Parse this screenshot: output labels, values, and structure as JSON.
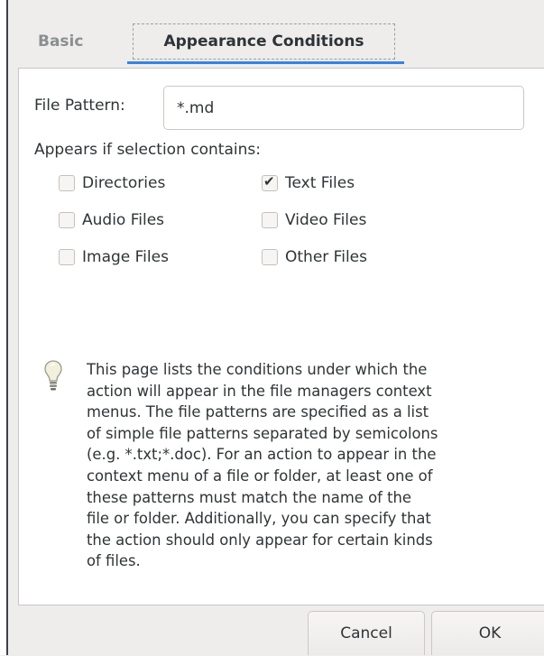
{
  "tabs": [
    {
      "label": "Basic",
      "active": false
    },
    {
      "label": "Appearance Conditions",
      "active": true
    }
  ],
  "file_pattern": {
    "label": "File Pattern:",
    "value": "*.md"
  },
  "appears_label": "Appears if selection contains:",
  "checkboxes": {
    "directories": {
      "label": "Directories",
      "checked": false
    },
    "text_files": {
      "label": "Text Files",
      "checked": true
    },
    "audio_files": {
      "label": "Audio Files",
      "checked": false
    },
    "video_files": {
      "label": "Video Files",
      "checked": false
    },
    "image_files": {
      "label": "Image Files",
      "checked": false
    },
    "other_files": {
      "label": "Other Files",
      "checked": false
    }
  },
  "info_text": "This page lists the conditions under which the\naction will appear in the file managers context\nmenus. The file patterns are specified as a list\nof simple file patterns separated by semicolons\n(e.g. *.txt;*.doc). For an action to appear in the\ncontext menu of a file or folder, at least one of\nthese patterns must match the name of the\nfile or folder. Additionally, you can specify that\nthe action should only appear for certain kinds\nof files.",
  "buttons": {
    "cancel": "Cancel",
    "ok": "OK"
  },
  "colors": {
    "accent": "#3584e4",
    "background": "#eeedec",
    "panel": "#ffffff"
  },
  "icons": {
    "info": "lightbulb-icon",
    "check": "checkmark-icon"
  }
}
